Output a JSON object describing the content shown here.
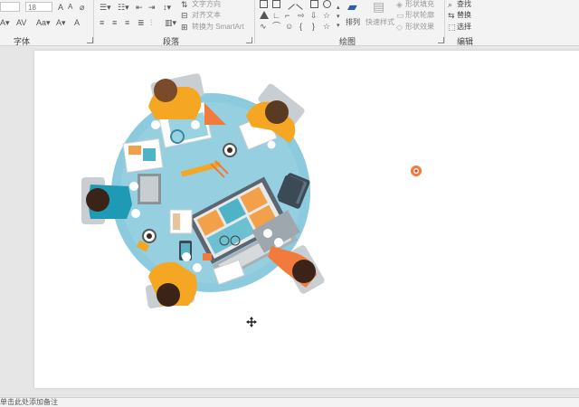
{
  "ribbon": {
    "font_group": {
      "label": "字体",
      "font_size_value": "18",
      "buttons": [
        "A",
        "A",
        "A"
      ]
    },
    "paragraph_group": {
      "label": "段落",
      "text_direction": "文字方向",
      "align_text": "对齐文本",
      "convert_smartart": "转换为 SmartArt"
    },
    "drawing_group": {
      "label": "绘图",
      "arrange": "排列",
      "quick_styles": "快速样式",
      "shape_fill": "形状填充",
      "shape_outline": "形状轮廓",
      "shape_effects": "形状效果"
    },
    "editing_group": {
      "label": "编辑",
      "find": "查找",
      "replace": "替换",
      "select": "选择"
    }
  },
  "illustration": {
    "name": "teamwork-table-top-view"
  },
  "status": {
    "notes_hint": "单击此处添加备注"
  },
  "colors": {
    "ribbon_bg": "#f3f3f3",
    "table_blue": "#8ccbdd",
    "orange": "#f07b3c",
    "sleeve_yellow": "#f5a623",
    "sleeve_teal": "#1e9ab5"
  }
}
